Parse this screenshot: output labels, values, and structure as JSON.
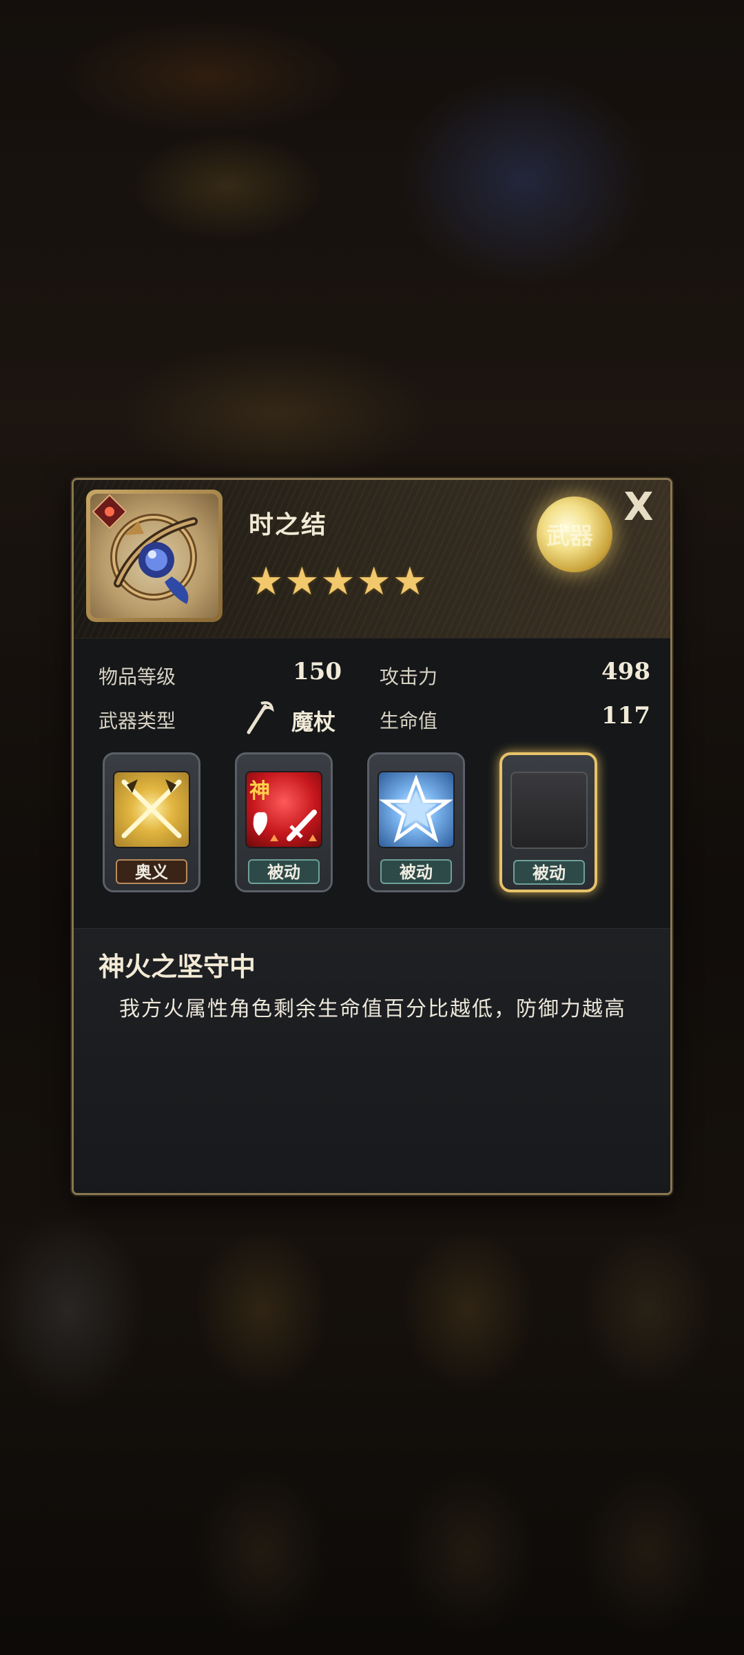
{
  "item": {
    "name": "时之结",
    "stars": 5,
    "orb_label": "武器"
  },
  "stats": {
    "item_level_label": "物品等级",
    "item_level_value": "150",
    "weapon_type_label": "武器类型",
    "weapon_type_value": "魔杖",
    "attack_label": "攻击力",
    "attack_value": "498",
    "hp_label": "生命值",
    "hp_value": "117"
  },
  "skills": [
    {
      "tag": "奥义",
      "icon": "crossed-swords-icon"
    },
    {
      "tag": "被动",
      "icon": "divine-fire-icon",
      "icon_text": "神"
    },
    {
      "tag": "被动",
      "icon": "blue-star-icon"
    },
    {
      "tag": "被动",
      "icon": "empty-slot-icon",
      "selected": true
    }
  ],
  "description": {
    "title": "神火之坚守中",
    "text": "我方火属性角色剩余生命值百分比越低，防御力越高"
  },
  "close_label": "X",
  "colors": {
    "gold_border": "#8a7650",
    "star": "#f1c86b",
    "selected_glow": "#e9c36a",
    "passive_tag": "#2d4a48",
    "ougi_tag": "#3a2418"
  }
}
